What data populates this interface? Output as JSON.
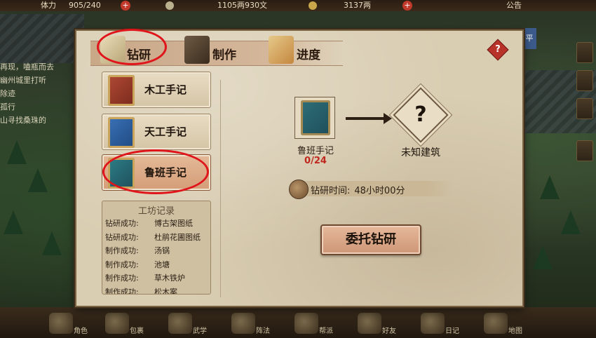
{
  "topbar": {
    "stamina_label": "体力",
    "stamina_value": "905/240",
    "money": "1105两930文",
    "gold": "3137两",
    "announcement": "公告"
  },
  "quests": [
    "再现，嗑瓶而去",
    "幽州城里打听",
    "除迹",
    "孤行",
    "山寻找桑珠的"
  ],
  "right_tag": "平",
  "tabs": [
    {
      "label": "钻研",
      "icon": "scroll-icon"
    },
    {
      "label": "制作",
      "icon": "tools-icon"
    },
    {
      "label": "进度",
      "icon": "progress-book-icon"
    }
  ],
  "recipes": [
    {
      "label": "木工手记",
      "color": "#9c3a2a",
      "icon": "red-book-icon"
    },
    {
      "label": "天工手记",
      "color": "#2f5fa0",
      "icon": "blue-book-icon"
    },
    {
      "label": "鲁班手记",
      "color": "#2d6f78",
      "icon": "teal-book-icon"
    }
  ],
  "log": {
    "title": "工坊记录",
    "entries": [
      {
        "prefix": "钻研成功:",
        "item": "博古架图纸"
      },
      {
        "prefix": "钻研成功:",
        "item": "杜鹃花圃图纸"
      },
      {
        "prefix": "制作成功:",
        "item": "汤锅"
      },
      {
        "prefix": "制作成功:",
        "item": "池塘"
      },
      {
        "prefix": "制作成功:",
        "item": "草木铁炉"
      },
      {
        "prefix": "制作成功:",
        "item": "松木案"
      }
    ]
  },
  "research": {
    "source_name": "鲁班手记",
    "source_count": "0/24",
    "target_name": "未知建筑",
    "target_symbol": "?",
    "time_label": "钻研时间:",
    "time_value": "48小时00分",
    "commission_button": "委托钻研"
  },
  "bottom_nav": [
    "角色",
    "包裹",
    "武学",
    "阵法",
    "帮派",
    "好友",
    "日记",
    "地图"
  ]
}
